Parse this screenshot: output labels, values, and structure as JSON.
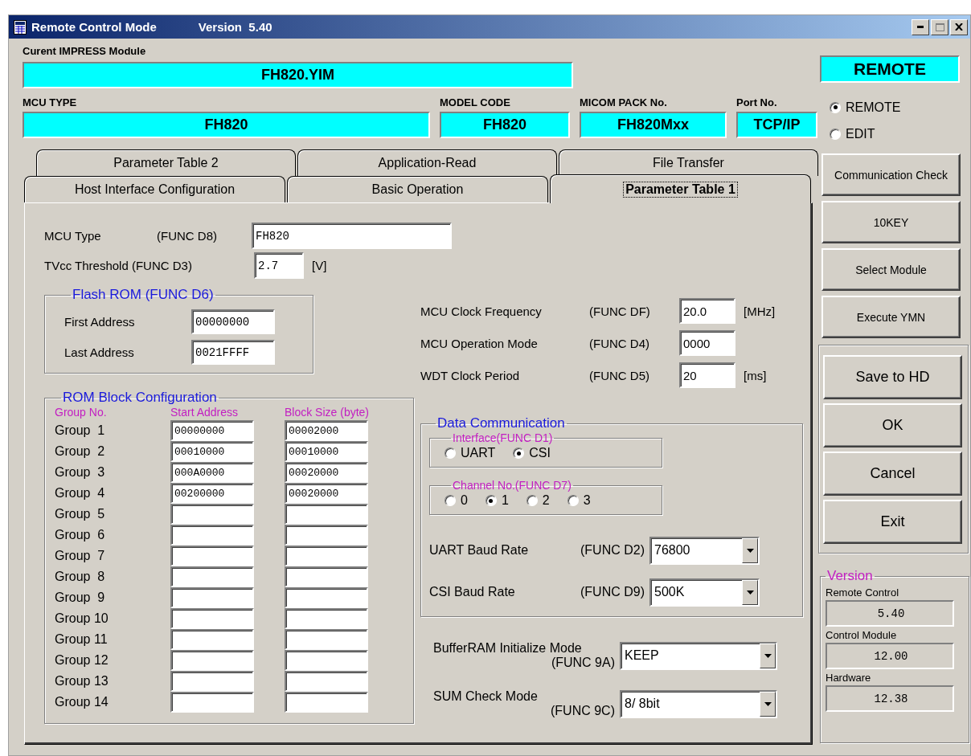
{
  "window": {
    "title": "Remote Control Mode",
    "version": "Version  5.40"
  },
  "module": {
    "label": "Curent IMPRESS Module",
    "value": "FH820.YIM"
  },
  "info_fields": [
    {
      "label": "MCU TYPE",
      "value": "FH820"
    },
    {
      "label": "MODEL CODE",
      "value": "FH820"
    },
    {
      "label": "MICOM PACK No.",
      "value": "FH820Mxx"
    },
    {
      "label": "Port No.",
      "value": "TCP/IP"
    }
  ],
  "mode": {
    "badge": "REMOTE",
    "options": [
      {
        "label": "REMOTE",
        "selected": true
      },
      {
        "label": "EDIT",
        "selected": false
      }
    ]
  },
  "tab_rows": [
    {
      "tabs": [
        {
          "label": "Parameter Table 2",
          "selected": false
        },
        {
          "label": "Application-Read",
          "selected": false
        },
        {
          "label": "File Transfer",
          "selected": false
        }
      ]
    },
    {
      "tabs": [
        {
          "label": "Host Interface Configuration",
          "selected": false
        },
        {
          "label": "Basic Operation",
          "selected": false
        },
        {
          "label": "Parameter Table 1",
          "selected": true
        }
      ]
    }
  ],
  "parameters": {
    "mcu_type": {
      "label": "MCU Type",
      "func": "(FUNC D8)",
      "value": "FH820"
    },
    "tvcc": {
      "label": "TVcc Threshold (FUNC D3)",
      "value": "2.7",
      "unit": "[V]"
    },
    "flash_rom": {
      "title": "Flash ROM (FUNC D6)",
      "fields": [
        {
          "label": "First Address",
          "value": "00000000"
        },
        {
          "label": "Last Address",
          "value": "0021FFFF"
        }
      ]
    },
    "rom_blocks": {
      "title": "ROM Block Configuration",
      "headers": [
        "Group No.",
        "Start Address",
        "Block Size (byte)"
      ],
      "rows": [
        {
          "group": "Group  1",
          "start": "00000000",
          "size": "00002000"
        },
        {
          "group": "Group  2",
          "start": "00010000",
          "size": "00010000"
        },
        {
          "group": "Group  3",
          "start": "000A0000",
          "size": "00020000"
        },
        {
          "group": "Group  4",
          "start": "00200000",
          "size": "00020000"
        },
        {
          "group": "Group  5"
        },
        {
          "group": "Group  6"
        },
        {
          "group": "Group  7"
        },
        {
          "group": "Group  8"
        },
        {
          "group": "Group  9"
        },
        {
          "group": "Group 10"
        },
        {
          "group": "Group 11"
        },
        {
          "group": "Group 12"
        },
        {
          "group": "Group 13"
        },
        {
          "group": "Group 14"
        }
      ]
    },
    "clock_fields": [
      {
        "label": "MCU Clock Frequency",
        "func": "(FUNC DF)",
        "value": "20.0",
        "unit": "[MHz]"
      },
      {
        "label": "MCU Operation Mode",
        "func": "(FUNC D4)",
        "value": "0000"
      },
      {
        "label": "WDT Clock Period",
        "func": "(FUNC D5)",
        "value": "20",
        "unit": "[ms]"
      }
    ],
    "data_comm": {
      "title": "Data Communication",
      "interface": {
        "title": "Interface(FUNC D1)",
        "options": [
          {
            "label": "UART",
            "selected": false
          },
          {
            "label": "CSI",
            "selected": true
          }
        ]
      },
      "channel": {
        "title": "Channel No.(FUNC D7)",
        "options": [
          {
            "label": "0",
            "selected": false
          },
          {
            "label": "1",
            "selected": true
          },
          {
            "label": "2",
            "selected": false
          },
          {
            "label": "3",
            "selected": false
          }
        ]
      },
      "baud": [
        {
          "label": "UART Baud Rate",
          "func": "(FUNC D2)",
          "value": "76800"
        },
        {
          "label": "CSI Baud Rate",
          "func": "(FUNC D9)",
          "value": "500K"
        }
      ]
    },
    "modes": [
      {
        "label": "BufferRAM Initialize Mode",
        "func": "(FUNC 9A)",
        "value": "KEEP"
      },
      {
        "label": "SUM Check Mode",
        "func": "(FUNC 9C)",
        "value": "8/ 8bit"
      }
    ]
  },
  "side_buttons": [
    "Communication Check",
    "10KEY",
    "Select Module",
    "Execute YMN"
  ],
  "action_buttons": [
    "Save to HD",
    "OK",
    "Cancel",
    "Exit"
  ],
  "version": {
    "title": "Version",
    "items": [
      {
        "label": "Remote Control",
        "value": "5.40"
      },
      {
        "label": "Control Module",
        "value": "12.00"
      },
      {
        "label": "Hardware",
        "value": "12.38"
      }
    ]
  }
}
